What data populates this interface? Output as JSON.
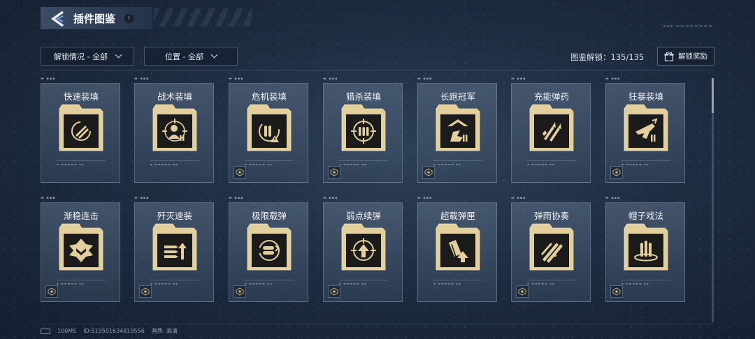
{
  "header": {
    "title": "插件图鉴",
    "info": "i"
  },
  "filters": {
    "unlock_filter": "解锁情况 - 全部",
    "position_filter": "位置 - 全部"
  },
  "stats": {
    "label": "图鉴解锁：",
    "value": "135/135"
  },
  "reward_button": {
    "label": "解锁奖励"
  },
  "colors": {
    "accent_gold": "#e3cf9c",
    "icon_bg": "#1b1b1b",
    "background": "#1e2d42"
  },
  "cards": [
    {
      "name": "快速装填",
      "icon": "rapid-reload-icon",
      "badge": false
    },
    {
      "name": "战术装填",
      "icon": "tactical-reload-icon",
      "badge": false
    },
    {
      "name": "危机装填",
      "icon": "crisis-reload-icon",
      "badge": true
    },
    {
      "name": "猎杀装填",
      "icon": "hunt-reload-icon",
      "badge": true
    },
    {
      "name": "长跑冠军",
      "icon": "marathon-champion-icon",
      "badge": true
    },
    {
      "name": "充能弹药",
      "icon": "charged-ammo-icon",
      "badge": false
    },
    {
      "name": "狂暴装填",
      "icon": "berserk-reload-icon",
      "badge": true
    },
    {
      "name": "渐稳连击",
      "icon": "steady-combo-icon",
      "badge": true
    },
    {
      "name": "歼灭速装",
      "icon": "annihilate-reload-icon",
      "badge": true
    },
    {
      "name": "极限载弹",
      "icon": "max-ammo-icon",
      "badge": true
    },
    {
      "name": "弱点续弹",
      "icon": "weakpoint-reload-icon",
      "badge": true
    },
    {
      "name": "超载弹匣",
      "icon": "overload-magazine-icon",
      "badge": false
    },
    {
      "name": "弹雨协奏",
      "icon": "bullet-rain-icon",
      "badge": true
    },
    {
      "name": "帽子戏法",
      "icon": "hat-trick-icon",
      "badge": true
    }
  ],
  "footer": {
    "ping": "100MS",
    "uid": "ID:519501634819556",
    "quality": "画质: 高清"
  }
}
